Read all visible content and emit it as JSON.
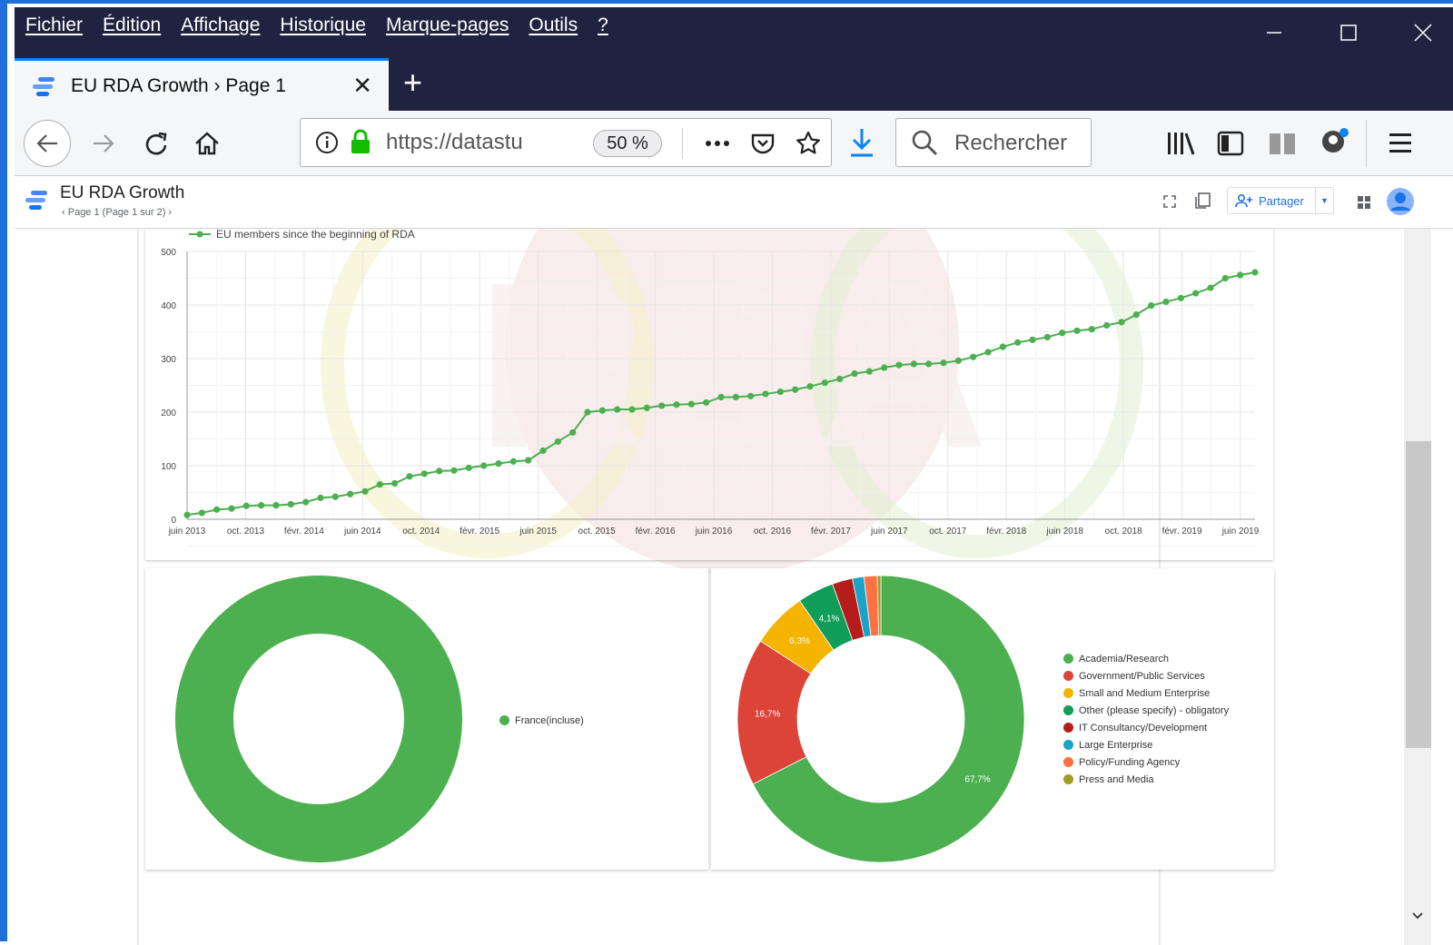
{
  "menu": [
    "Fichier",
    "Édition",
    "Affichage",
    "Historique",
    "Marque-pages",
    "Outils",
    "?"
  ],
  "tab": {
    "title": "EU RDA Growth › Page 1"
  },
  "url": {
    "text": "https://datastu",
    "zoom": "50 %"
  },
  "search": {
    "placeholder": "Rechercher"
  },
  "app": {
    "title": "EU RDA Growth",
    "page": "Page 1 (Page 1 sur 2)",
    "share_label": "Partager"
  },
  "colors": {
    "line": "#4caf50",
    "accent": "#1a73e8"
  },
  "watermark": {
    "text": "RDA"
  },
  "line_chart": {
    "legend": "EU members since the beginning of RDA",
    "y_ticks": [
      "500",
      "400",
      "300",
      "200",
      "100",
      "0"
    ],
    "x_ticks": [
      "juin 2013",
      "oct. 2013",
      "févr. 2014",
      "juin 2014",
      "oct. 2014",
      "févr. 2015",
      "juin 2015",
      "oct. 2015",
      "févr. 2016",
      "juin 2016",
      "oct. 2016",
      "févr. 2017",
      "juin 2017",
      "oct. 2017",
      "févr. 2018",
      "juin 2018",
      "oct. 2018",
      "févr. 2019",
      "juin 2019"
    ]
  },
  "pie1": {
    "legend": "France(incluse)"
  },
  "pie2": {
    "legend": [
      "Academia/Research",
      "Government/Public Services",
      "Small and Medium Enterprise",
      "Other (please specify) - obligatory",
      "IT Consultancy/Development",
      "Large Enterprise",
      "Policy/Funding Agency",
      "Press and Media"
    ],
    "labels": {
      "academia": "67,7%",
      "government": "16,7%",
      "sme": "6,3%",
      "other": "4,1%"
    }
  },
  "chart_data": [
    {
      "type": "line",
      "title": "",
      "series": [
        {
          "name": "EU members since the beginning of RDA",
          "values": [
            8,
            12,
            18,
            20,
            25,
            26,
            26,
            28,
            32,
            40,
            42,
            47,
            52,
            65,
            67,
            80,
            85,
            90,
            91,
            96,
            100,
            104,
            108,
            110,
            128,
            145,
            162,
            200,
            203,
            205,
            205,
            208,
            212,
            214,
            215,
            218,
            228,
            228,
            230,
            234,
            238,
            242,
            248,
            255,
            262,
            272,
            276,
            283,
            288,
            290,
            290,
            292,
            296,
            303,
            312,
            322,
            330,
            335,
            340,
            348,
            352,
            355,
            362,
            368,
            382,
            399,
            406,
            413,
            422,
            432,
            450,
            456,
            461
          ]
        }
      ],
      "x_start": "juin 2013",
      "x_end": "juin 2019",
      "ylim": [
        0,
        500
      ],
      "grid": true,
      "legend_position": "top-left"
    },
    {
      "type": "pie",
      "categories": [
        "France(incluse)"
      ],
      "values": [
        100
      ],
      "donut": true
    },
    {
      "type": "pie",
      "donut": true,
      "categories": [
        "Academia/Research",
        "Government/Public Services",
        "Small and Medium Enterprise",
        "Other (please specify) - obligatory",
        "IT Consultancy/Development",
        "Large Enterprise",
        "Policy/Funding Agency",
        "Press and Media"
      ],
      "values": [
        67.7,
        16.7,
        6.3,
        4.1,
        2.3,
        1.3,
        1.5,
        0.4
      ],
      "colors": [
        "#4caf50",
        "#db4437",
        "#f4b400",
        "#0f9d58",
        "#b71c1c",
        "#1aa3c7",
        "#ff7043",
        "#9e9d24"
      ]
    }
  ]
}
